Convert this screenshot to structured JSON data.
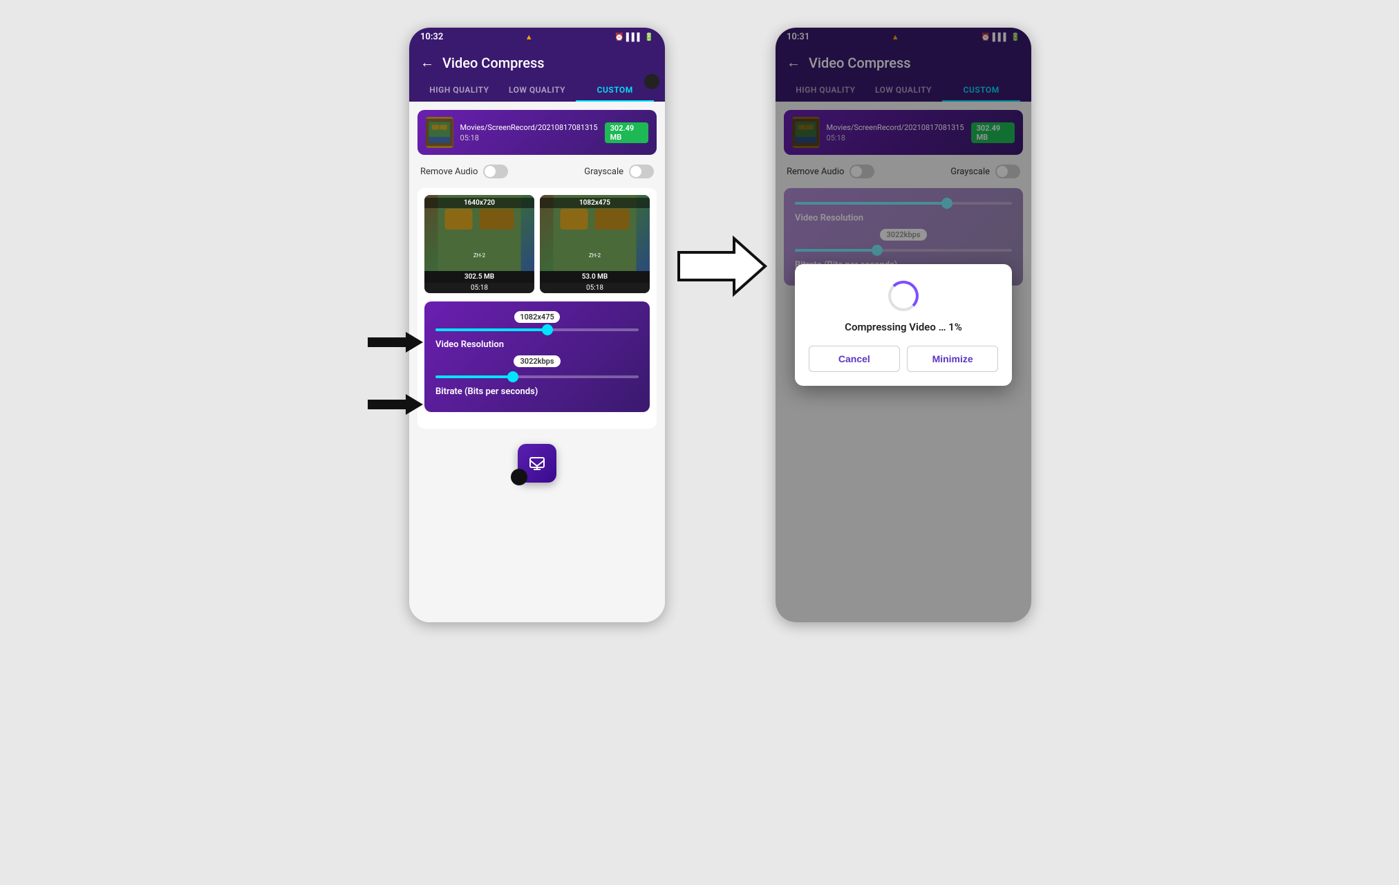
{
  "left_phone": {
    "status": {
      "time": "10:32",
      "alert": "▲",
      "icons": "🕐 ▌▌ 🔋"
    },
    "header": {
      "back": "←",
      "title": "Video Compress"
    },
    "tabs": [
      {
        "label": "HIGH QUALITY",
        "active": false
      },
      {
        "label": "LOW QUALITY",
        "active": false
      },
      {
        "label": "CUSTOM",
        "active": true
      }
    ],
    "file": {
      "path": "Movies/ScreenRecord/20210817081315",
      "duration": "05:18",
      "size": "302.49 MB"
    },
    "toggle_remove_audio": "Remove Audio",
    "toggle_grayscale": "Grayscale",
    "preview": {
      "original": {
        "dim": "1640x720",
        "size": "302.5 MB",
        "time": "05:18"
      },
      "compressed": {
        "dim": "1082x475",
        "size": "53.0 MB",
        "time": "05:18"
      }
    },
    "slider_resolution": {
      "label": "1082x475",
      "section_label": "Video Resolution"
    },
    "slider_bitrate": {
      "label": "3022kbps",
      "section_label": "Bitrate (Bits per seconds)"
    }
  },
  "right_phone": {
    "status": {
      "time": "10:31",
      "alert": "▲",
      "icons": "🕐 ▌▌ 🔋"
    },
    "header": {
      "back": "←",
      "title": "Video Compress"
    },
    "tabs": [
      {
        "label": "HIGH QUALITY",
        "active": false
      },
      {
        "label": "LOW QUALITY",
        "active": false
      },
      {
        "label": "CUSTOM",
        "active": true
      }
    ],
    "file": {
      "path": "Movies/ScreenRecord/20210817081315",
      "duration": "05:18",
      "size": "302.49 MB"
    },
    "toggle_remove_audio": "Remove Audio",
    "toggle_grayscale": "Grayscale",
    "dialog": {
      "title": "Compressing Video … 1%",
      "cancel": "Cancel",
      "minimize": "Minimize"
    },
    "slider_resolution": {
      "label": "Video Resolution",
      "value": "3022kbps"
    },
    "slider_bitrate": {
      "label": "Bitrate (Bits per seconds)"
    }
  },
  "arrow_label": "→"
}
